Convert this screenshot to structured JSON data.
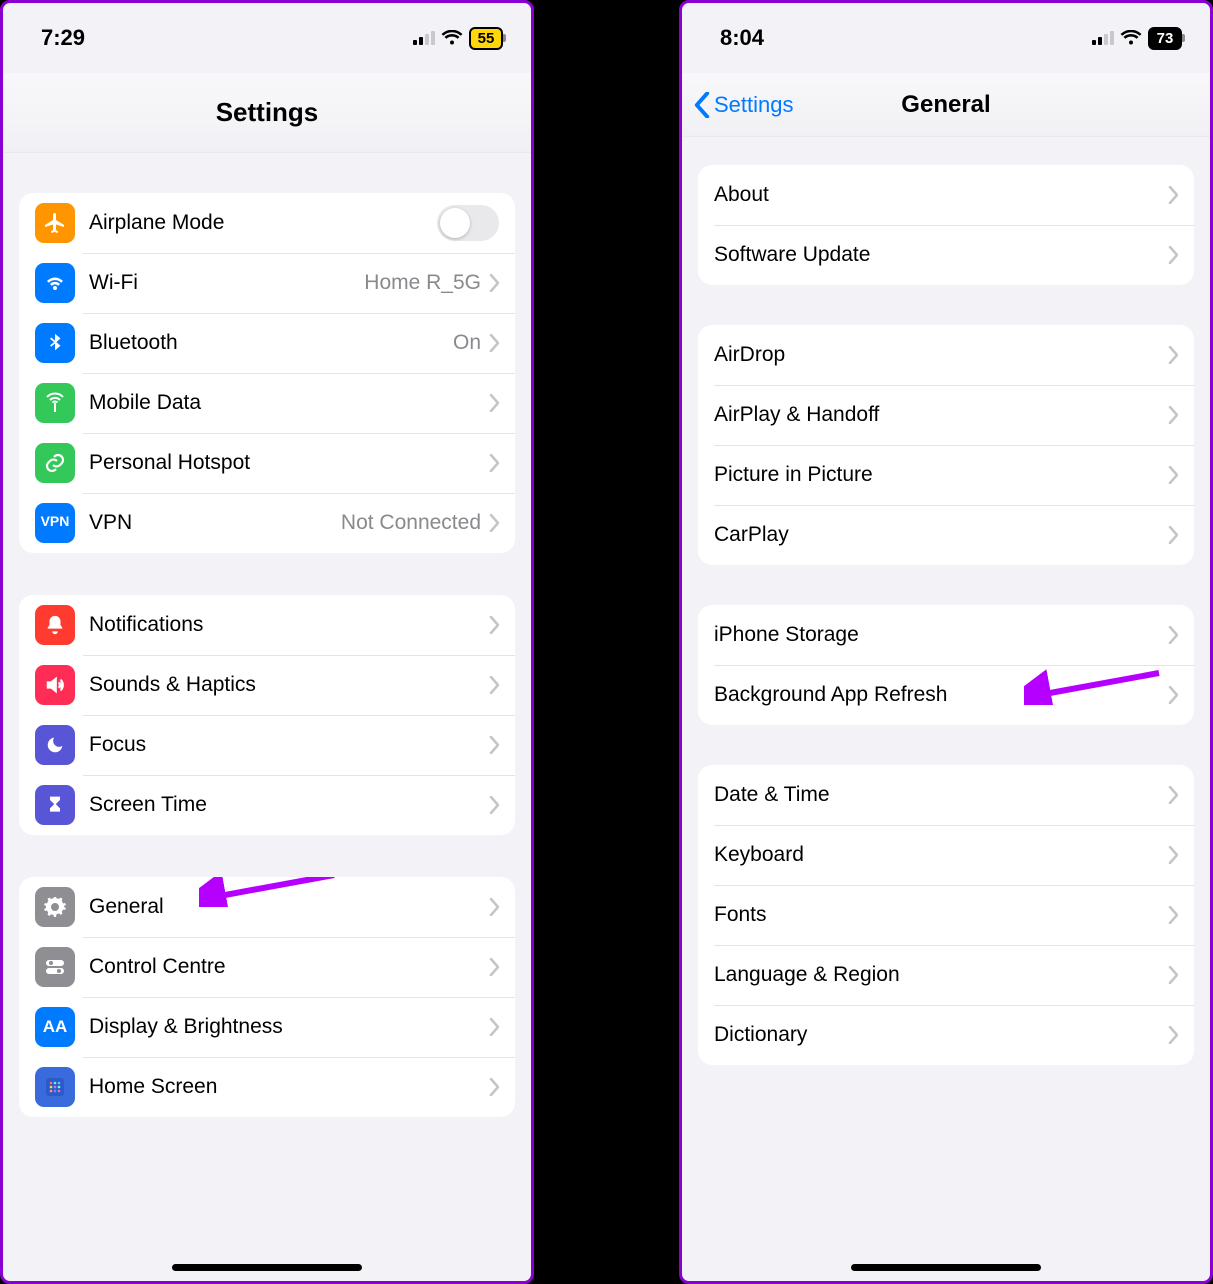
{
  "left": {
    "status": {
      "time": "7:29",
      "battery": "55"
    },
    "title": "Settings",
    "groups": [
      [
        {
          "key": "airplane",
          "label": "Airplane Mode",
          "icon": "airplane",
          "bg": "bg-orange",
          "toggle": false
        },
        {
          "key": "wifi",
          "label": "Wi-Fi",
          "value": "Home R_5G",
          "icon": "wifi",
          "bg": "bg-blue",
          "chevron": true
        },
        {
          "key": "bluetooth",
          "label": "Bluetooth",
          "value": "On",
          "icon": "bluetooth",
          "bg": "bg-blue",
          "chevron": true
        },
        {
          "key": "mobiledata",
          "label": "Mobile Data",
          "icon": "antenna",
          "bg": "bg-green",
          "chevron": true
        },
        {
          "key": "hotspot",
          "label": "Personal Hotspot",
          "icon": "link",
          "bg": "bg-green",
          "chevron": true
        },
        {
          "key": "vpn",
          "label": "VPN",
          "value": "Not Connected",
          "icon": "vpn",
          "bg": "bg-blue",
          "chevron": true
        }
      ],
      [
        {
          "key": "notifications",
          "label": "Notifications",
          "icon": "bell",
          "bg": "bg-red",
          "chevron": true
        },
        {
          "key": "sounds",
          "label": "Sounds & Haptics",
          "icon": "speaker",
          "bg": "bg-pink",
          "chevron": true
        },
        {
          "key": "focus",
          "label": "Focus",
          "icon": "moon",
          "bg": "bg-indigo",
          "chevron": true
        },
        {
          "key": "screentime",
          "label": "Screen Time",
          "icon": "hourglass",
          "bg": "bg-indigo",
          "chevron": true
        }
      ],
      [
        {
          "key": "general",
          "label": "General",
          "icon": "gear",
          "bg": "bg-gray",
          "chevron": true,
          "annot": true
        },
        {
          "key": "controlcentre",
          "label": "Control Centre",
          "icon": "switches",
          "bg": "bg-gray",
          "chevron": true
        },
        {
          "key": "display",
          "label": "Display & Brightness",
          "icon": "aa",
          "bg": "bg-blue",
          "chevron": true
        },
        {
          "key": "homescreen",
          "label": "Home Screen",
          "icon": "grid",
          "bg": "bg-homescreen",
          "chevron": true
        }
      ]
    ]
  },
  "right": {
    "status": {
      "time": "8:04",
      "battery": "73"
    },
    "back": "Settings",
    "title": "General",
    "groups": [
      [
        {
          "key": "about",
          "label": "About"
        },
        {
          "key": "softwareupdate",
          "label": "Software Update"
        }
      ],
      [
        {
          "key": "airdrop",
          "label": "AirDrop"
        },
        {
          "key": "airplay",
          "label": "AirPlay & Handoff"
        },
        {
          "key": "pip",
          "label": "Picture in Picture"
        },
        {
          "key": "carplay",
          "label": "CarPlay"
        }
      ],
      [
        {
          "key": "storage",
          "label": "iPhone Storage"
        },
        {
          "key": "backgroundrefresh",
          "label": "Background App Refresh",
          "annot": true
        }
      ],
      [
        {
          "key": "datetime",
          "label": "Date & Time"
        },
        {
          "key": "keyboard",
          "label": "Keyboard"
        },
        {
          "key": "fonts",
          "label": "Fonts"
        },
        {
          "key": "language",
          "label": "Language & Region"
        },
        {
          "key": "dictionary",
          "label": "Dictionary"
        }
      ]
    ]
  }
}
